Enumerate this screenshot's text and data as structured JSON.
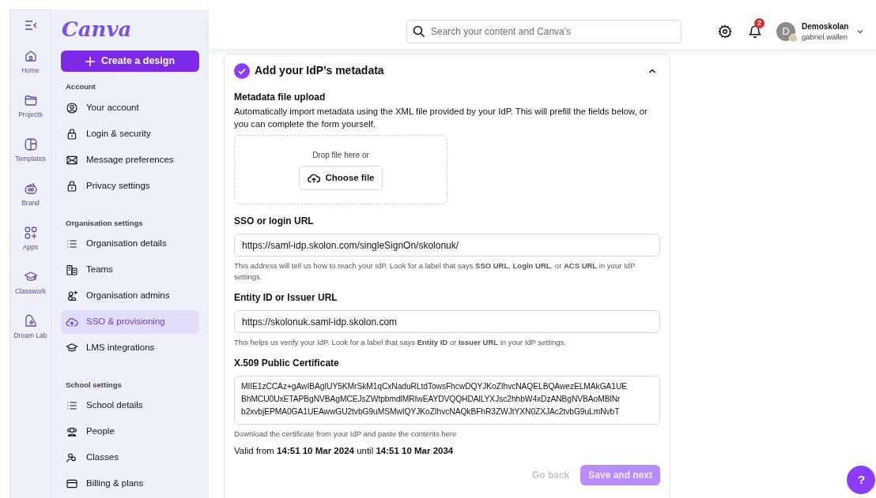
{
  "rail": [
    {
      "label": "Home",
      "selected": false
    },
    {
      "label": "Projects",
      "selected": false
    },
    {
      "label": "Templates",
      "selected": false
    },
    {
      "label": "Brand",
      "selected": false
    },
    {
      "label": "Apps",
      "selected": false
    },
    {
      "label": "Classwork",
      "selected": false
    },
    {
      "label": "Dream Lab",
      "selected": false
    }
  ],
  "logo": "Canva",
  "create_button": "Create a design",
  "sidebar": [
    {
      "title": "Account",
      "items": [
        {
          "label": "Your account",
          "selected": false
        },
        {
          "label": "Login & security",
          "selected": false
        },
        {
          "label": "Message preferences",
          "selected": false
        },
        {
          "label": "Privacy settings",
          "selected": false
        }
      ]
    },
    {
      "title": "Organisation settings",
      "items": [
        {
          "label": "Organisation details",
          "selected": false
        },
        {
          "label": "Teams",
          "selected": false
        },
        {
          "label": "Organisation admins",
          "selected": false
        },
        {
          "label": "SSO & provisioning",
          "selected": true
        },
        {
          "label": "LMS integrations",
          "selected": false
        }
      ]
    },
    {
      "title": "School settings",
      "items": [
        {
          "label": "School details",
          "selected": false
        },
        {
          "label": "People",
          "selected": false
        },
        {
          "label": "Classes",
          "selected": false
        },
        {
          "label": "Billing & plans",
          "selected": false
        }
      ]
    }
  ],
  "search": {
    "placeholder": "Search your content and Canva's"
  },
  "notifications": {
    "count": "2"
  },
  "account": {
    "initial": "D",
    "name": "Demoskolan",
    "user": "gabriel.wallen"
  },
  "section": {
    "title": "Add your IdP’s metadata",
    "completed": true,
    "expanded": true
  },
  "upload": {
    "label": "Metadata file upload",
    "description": "Automatically import metadata using the XML file provided by your IdP. This will prefill the fields below, or you can complete the form yourself.",
    "drop_text": "Drop file here or",
    "button": "Choose file"
  },
  "fields": [
    {
      "label": "SSO or login URL",
      "value": "https://saml-idp.skolon.com/singleSignOn/skolonuk/",
      "help": "This address will tell us how to reach your IdP. Look for a label that says **SSO URL**, **Login URL**, or **ACS URL** in your IdP settings."
    },
    {
      "label": "Entity ID or Issuer URL",
      "value": "https://skolonuk.saml-idp.skolon.com",
      "help": "This helps us verify your IdP. Look for a label that says **Entity ID** or **Issuer URL** in your IdP settings."
    }
  ],
  "certificate": {
    "label": "X.509 Public Certificate",
    "lines": [
      "MIIE1zCCAz+gAwIBAgIUY5KMrSkM1qCxNaduRLtdTowsFhcwDQYJKoZIhvcNAQELBQAwezELMAkGA1UE",
      "BhMCU0UxETAPBgNVBAgMCEJsZWtpbmdlMRIwEAYDVQQHDAlLYXJsc2hhbW4xDzANBgNVBAoMBlNr",
      "b2xvbjEPMA0GA1UEAwwGU2tvbG9uMSMwIQYJKoZIhvcNAQkBFhR3ZWJtYXN0ZXJAc2tvbG9uLmNvbT"
    ],
    "help": "Download the certificate from your IdP and paste the contents here",
    "validity": "Valid from **14:51 10 Mar 2024** until **14:51 10 Mar 2034**"
  },
  "actions": {
    "back": "Go back",
    "next": "Save and next"
  },
  "help_button": "?"
}
